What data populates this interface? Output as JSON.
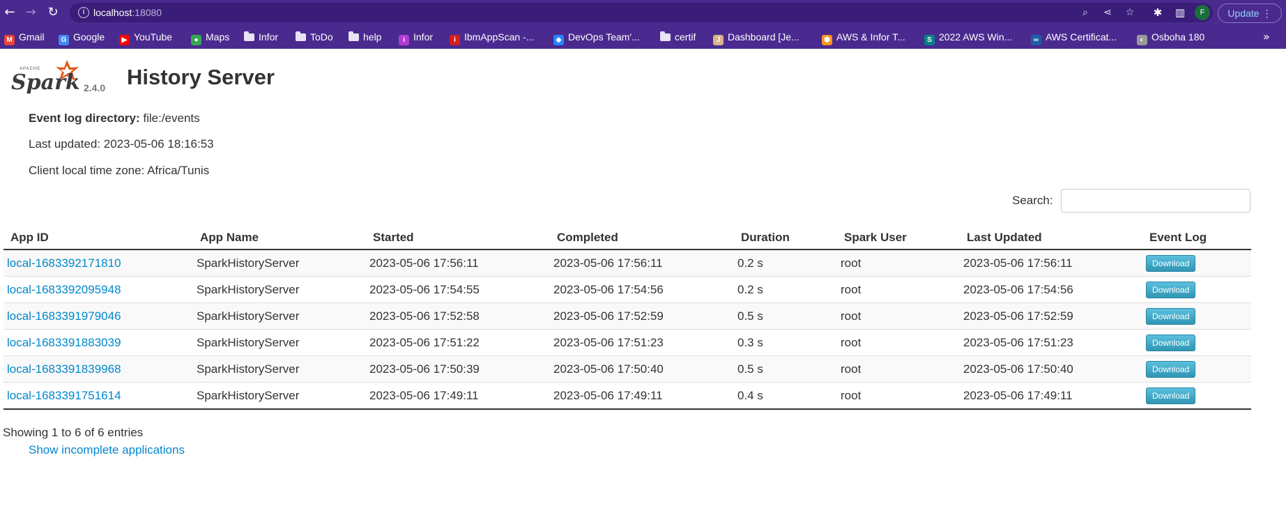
{
  "browser": {
    "url_host": "localhost",
    "url_port": ":18080",
    "update_label": "Update",
    "profile_initial": "F",
    "bookmarks": [
      {
        "label": "Gmail",
        "icon": "gmail-icon",
        "type": "site",
        "color": "#ea4335",
        "glyph": "M"
      },
      {
        "label": "Google",
        "icon": "google-icon",
        "type": "site",
        "color": "#4285f4",
        "glyph": "G"
      },
      {
        "label": "YouTube",
        "icon": "youtube-icon",
        "type": "site",
        "color": "#ff0000",
        "glyph": "▶"
      },
      {
        "label": "Maps",
        "icon": "maps-icon",
        "type": "site",
        "color": "#34a853",
        "glyph": "●"
      },
      {
        "label": "Infor",
        "icon": "folder-icon",
        "type": "folder"
      },
      {
        "label": "ToDo",
        "icon": "folder-icon",
        "type": "folder"
      },
      {
        "label": "help",
        "icon": "folder-icon",
        "type": "folder"
      },
      {
        "label": "Infor",
        "icon": "infor-icon",
        "type": "site",
        "color": "#b23ad1",
        "glyph": "i"
      },
      {
        "label": "IbmAppScan -...",
        "icon": "appscan-icon",
        "type": "site",
        "color": "#d11f1f",
        "glyph": "i"
      },
      {
        "label": "DevOps Team'...",
        "icon": "jira-icon",
        "type": "site",
        "color": "#2684ff",
        "glyph": "◆"
      },
      {
        "label": "certif",
        "icon": "folder-icon",
        "type": "folder"
      },
      {
        "label": "Dashboard [Je...",
        "icon": "jenkins-icon",
        "type": "site",
        "color": "#d9b38c",
        "glyph": "J"
      },
      {
        "label": "AWS & Infor T...",
        "icon": "aws-icon",
        "type": "site",
        "color": "#f7941d",
        "glyph": "⬢"
      },
      {
        "label": "2022 AWS Win...",
        "icon": "sharepoint-icon",
        "type": "site",
        "color": "#038387",
        "glyph": "S"
      },
      {
        "label": "AWS Certificat...",
        "icon": "aws-cert-icon",
        "type": "site",
        "color": "#1f5fa8",
        "glyph": "∞"
      },
      {
        "label": "Osboha 180",
        "icon": "osboha-icon",
        "type": "site",
        "color": "#9a9a9a",
        "glyph": "◐"
      }
    ]
  },
  "spark": {
    "version": "2.4.0",
    "title": "History Server",
    "event_log_label": "Event log directory:",
    "event_log_value": "file:/events",
    "last_updated": "Last updated: 2023-05-06 18:16:53",
    "timezone": "Client local time zone: Africa/Tunis",
    "search_label": "Search:",
    "search_value": "",
    "columns": [
      "App ID",
      "App Name",
      "Started",
      "Completed",
      "Duration",
      "Spark User",
      "Last Updated",
      "Event Log"
    ],
    "rows": [
      {
        "app_id": "local-1683392171810",
        "app_name": "SparkHistoryServer",
        "started": "2023-05-06 17:56:11",
        "completed": "2023-05-06 17:56:11",
        "duration": "0.2 s",
        "user": "root",
        "last_updated": "2023-05-06 17:56:11",
        "event_log": "Download"
      },
      {
        "app_id": "local-1683392095948",
        "app_name": "SparkHistoryServer",
        "started": "2023-05-06 17:54:55",
        "completed": "2023-05-06 17:54:56",
        "duration": "0.2 s",
        "user": "root",
        "last_updated": "2023-05-06 17:54:56",
        "event_log": "Download"
      },
      {
        "app_id": "local-1683391979046",
        "app_name": "SparkHistoryServer",
        "started": "2023-05-06 17:52:58",
        "completed": "2023-05-06 17:52:59",
        "duration": "0.5 s",
        "user": "root",
        "last_updated": "2023-05-06 17:52:59",
        "event_log": "Download"
      },
      {
        "app_id": "local-1683391883039",
        "app_name": "SparkHistoryServer",
        "started": "2023-05-06 17:51:22",
        "completed": "2023-05-06 17:51:23",
        "duration": "0.3 s",
        "user": "root",
        "last_updated": "2023-05-06 17:51:23",
        "event_log": "Download"
      },
      {
        "app_id": "local-1683391839968",
        "app_name": "SparkHistoryServer",
        "started": "2023-05-06 17:50:39",
        "completed": "2023-05-06 17:50:40",
        "duration": "0.5 s",
        "user": "root",
        "last_updated": "2023-05-06 17:50:40",
        "event_log": "Download"
      },
      {
        "app_id": "local-1683391751614",
        "app_name": "SparkHistoryServer",
        "started": "2023-05-06 17:49:11",
        "completed": "2023-05-06 17:49:11",
        "duration": "0.4 s",
        "user": "root",
        "last_updated": "2023-05-06 17:49:11",
        "event_log": "Download"
      }
    ],
    "showing": "Showing 1 to 6 of 6 entries",
    "show_incomplete": "Show incomplete applications"
  },
  "colors": {
    "chrome_bg": "#4a2a8f",
    "link": "#0088cc",
    "download_btn": "#2f96b4",
    "spark_orange": "#e25a1c"
  }
}
